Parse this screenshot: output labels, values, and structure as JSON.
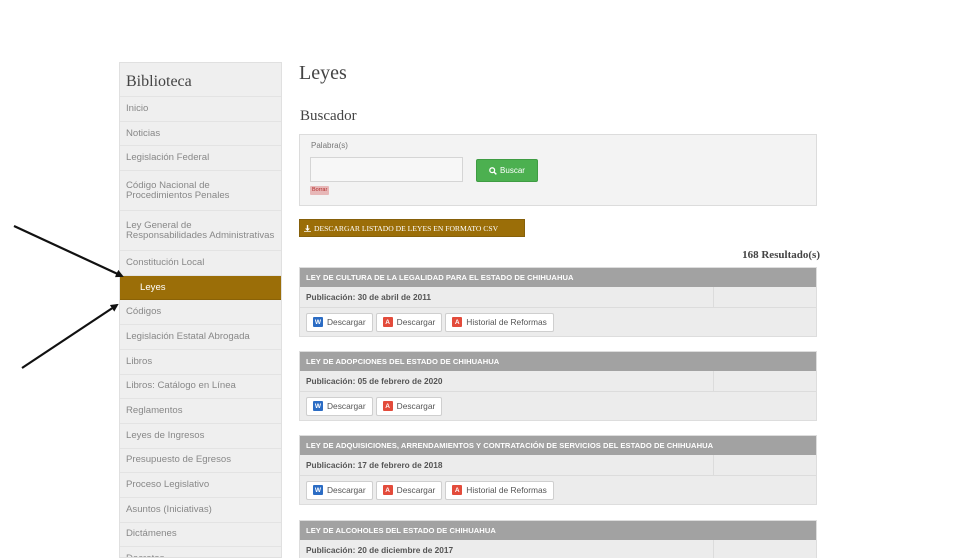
{
  "sidebar": {
    "title": "Biblioteca",
    "items": [
      {
        "label": "Inicio"
      },
      {
        "label": "Noticias"
      },
      {
        "label": "Legislación Federal"
      },
      {
        "label": "Código Nacional de Procedimientos Penales"
      },
      {
        "label": "Ley General de Responsabilidades Administrativas"
      },
      {
        "label": "Constitución Local"
      },
      {
        "label": "Leyes"
      },
      {
        "label": "Códigos"
      },
      {
        "label": "Legislación Estatal Abrogada"
      },
      {
        "label": "Libros"
      },
      {
        "label": "Libros: Catálogo en Línea"
      },
      {
        "label": "Reglamentos"
      },
      {
        "label": "Leyes de Ingresos"
      },
      {
        "label": "Presupuesto de Egresos"
      },
      {
        "label": "Proceso Legislativo"
      },
      {
        "label": "Asuntos (Iniciativas)"
      },
      {
        "label": "Dictámenes"
      },
      {
        "label": "Decretos"
      }
    ]
  },
  "main": {
    "title": "Leyes",
    "search_title": "Buscador",
    "search_label": "Palabra(s)",
    "search_value": "",
    "search_button": "Buscar",
    "clear_label": "Borrar",
    "csv_button": "DESCARGAR LISTADO DE LEYES EN FORMATO CSV",
    "result_count": "168 Resultado(s)"
  },
  "laws": [
    {
      "title": "LEY DE CULTURA DE LA LEGALIDAD PARA EL ESTADO DE CHIHUAHUA",
      "publication": "Publicación: 30 de abril de 2011",
      "word_label": "Descargar",
      "pdf_label": "Descargar",
      "history_label": "Historial de Reformas"
    },
    {
      "title": "LEY DE ADOPCIONES DEL ESTADO DE CHIHUAHUA",
      "publication": "Publicación: 05 de febrero de 2020",
      "word_label": "Descargar",
      "pdf_label": "Descargar"
    },
    {
      "title": "LEY DE ADQUISICIONES, ARRENDAMIENTOS Y CONTRATACIÓN DE SERVICIOS DEL ESTADO DE CHIHUAHUA",
      "publication": "Publicación: 17 de febrero de 2018",
      "word_label": "Descargar",
      "pdf_label": "Descargar",
      "history_label": "Historial de Reformas"
    },
    {
      "title": "LEY DE ALCOHOLES DEL ESTADO DE CHIHUAHUA",
      "publication": "Publicación: 20 de diciembre de 2017"
    }
  ],
  "icons": {
    "word": "W",
    "pdf": "A",
    "search": "search-icon",
    "download": "download-icon"
  },
  "colors": {
    "accent": "#9b6e08",
    "search_button": "#4cb050",
    "law_header": "#a2a2a2"
  }
}
